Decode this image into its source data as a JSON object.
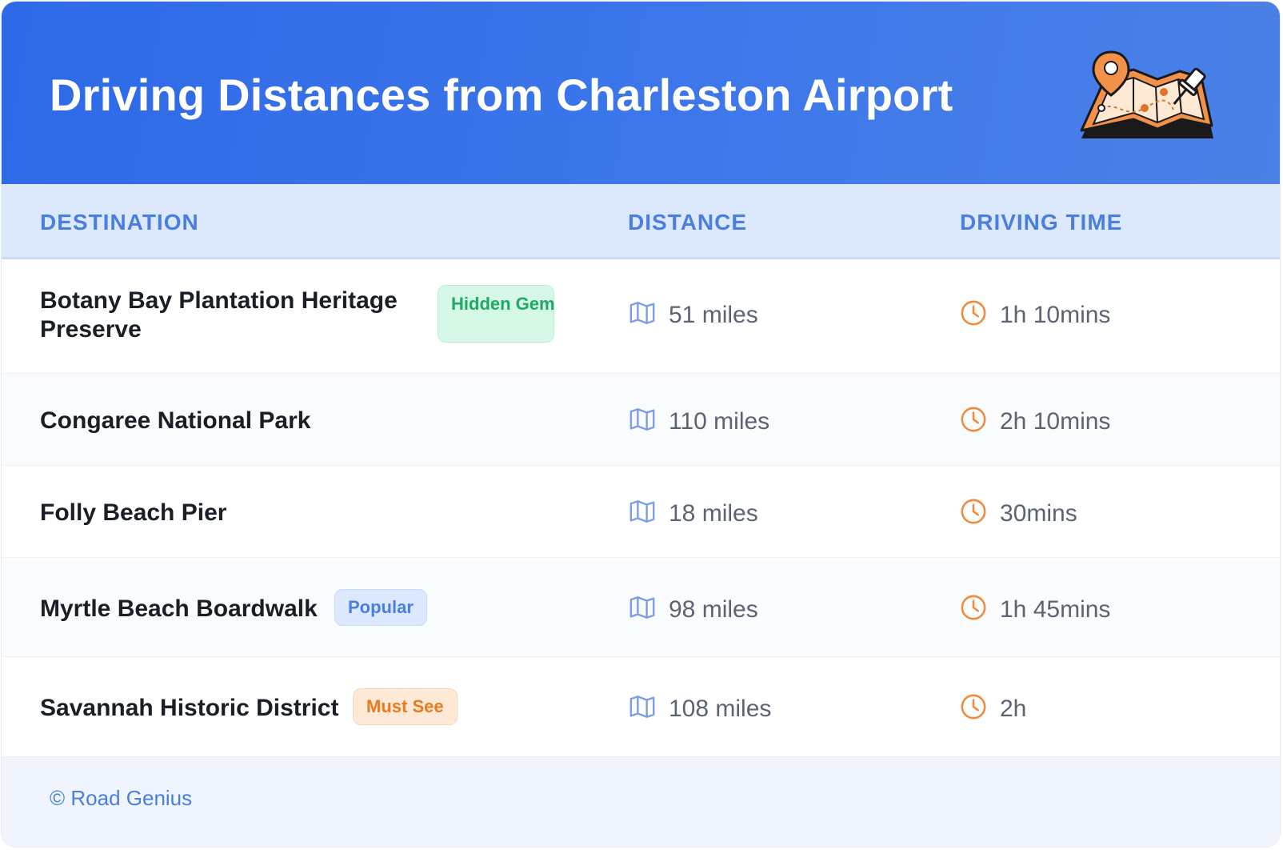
{
  "title": "Driving Distances from Charleston Airport",
  "header_icon": "map-pin-icon",
  "columns": {
    "destination": "DESTINATION",
    "distance": "DISTANCE",
    "driving_time": "DRIVING TIME"
  },
  "rows": [
    {
      "destination": "Botany Bay Plantation Heritage Preserve",
      "badge": "Hidden Gem",
      "badge_color": "#1fa866",
      "distance": "51 miles",
      "time": "1h 10mins"
    },
    {
      "destination": "Congaree National Park",
      "badge": "",
      "distance": "110 miles",
      "time": "2h 10mins"
    },
    {
      "destination": "Folly Beach Pier",
      "badge": "",
      "distance": "18 miles",
      "time": "30mins"
    },
    {
      "destination": "Myrtle Beach Boardwalk",
      "badge": "Popular",
      "badge_color": "#4a7fe0",
      "distance": "98 miles",
      "time": "1h 45mins"
    },
    {
      "destination": "Savannah Historic District",
      "badge": "Must See",
      "badge_color": "#ea7a1f",
      "distance": "108 miles",
      "time": "2h"
    }
  ],
  "icons": {
    "distance": "map-icon",
    "time": "clock-icon"
  },
  "footer": "© Road Genius",
  "colors": {
    "accent": "#3d77ea",
    "header_bg": "#dce8fc",
    "clock": "#f08a3c",
    "map": "#7d9ee6"
  }
}
